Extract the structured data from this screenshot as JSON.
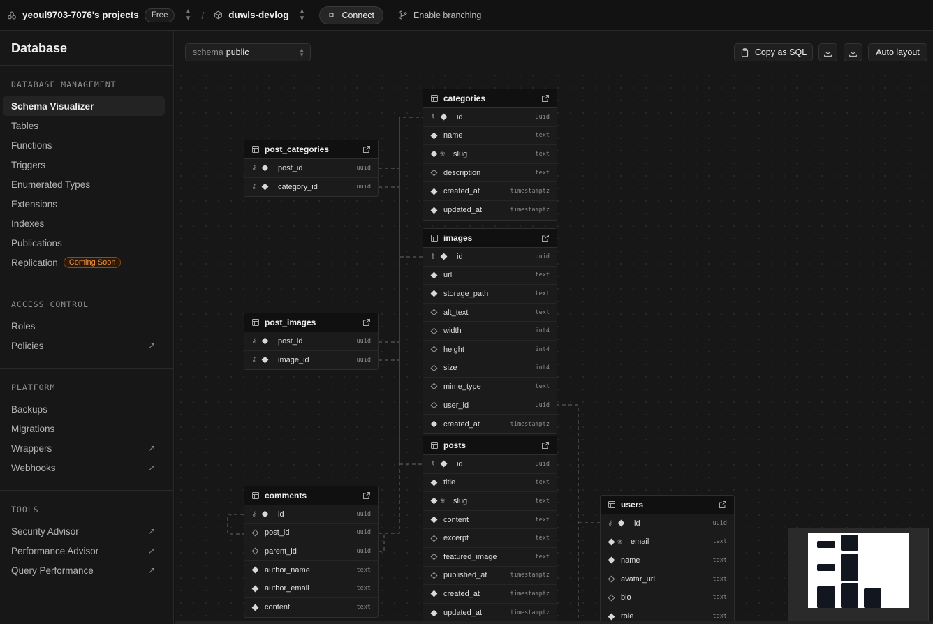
{
  "topbar": {
    "org": "yeoul9703-7076's projects",
    "plan": "Free",
    "project": "duwls-devlog",
    "connect": "Connect",
    "branching": "Enable branching"
  },
  "sidebar": {
    "title": "Database",
    "sections": [
      {
        "heading": "DATABASE MANAGEMENT",
        "items": [
          {
            "label": "Schema Visualizer",
            "active": true
          },
          {
            "label": "Tables"
          },
          {
            "label": "Functions"
          },
          {
            "label": "Triggers"
          },
          {
            "label": "Enumerated Types"
          },
          {
            "label": "Extensions"
          },
          {
            "label": "Indexes"
          },
          {
            "label": "Publications"
          },
          {
            "label": "Replication",
            "badge": "Coming Soon"
          }
        ]
      },
      {
        "heading": "ACCESS CONTROL",
        "items": [
          {
            "label": "Roles"
          },
          {
            "label": "Policies",
            "external": true
          }
        ]
      },
      {
        "heading": "PLATFORM",
        "items": [
          {
            "label": "Backups"
          },
          {
            "label": "Migrations"
          },
          {
            "label": "Wrappers",
            "external": true
          },
          {
            "label": "Webhooks",
            "external": true
          }
        ]
      },
      {
        "heading": "TOOLS",
        "items": [
          {
            "label": "Security Advisor",
            "external": true
          },
          {
            "label": "Performance Advisor",
            "external": true
          },
          {
            "label": "Query Performance",
            "external": true
          }
        ]
      }
    ]
  },
  "toolbar": {
    "schema_label": "schema",
    "schema_value": "public",
    "copy_sql": "Copy as SQL",
    "auto_layout": "Auto layout"
  },
  "tables": {
    "categories": {
      "name": "categories",
      "columns": [
        {
          "name": "id",
          "type": "uuid",
          "pk": true,
          "nullable": false
        },
        {
          "name": "name",
          "type": "text",
          "nullable": false
        },
        {
          "name": "slug",
          "type": "text",
          "unique": true,
          "nullable": false
        },
        {
          "name": "description",
          "type": "text",
          "nullable": true
        },
        {
          "name": "created_at",
          "type": "timestamptz",
          "nullable": false
        },
        {
          "name": "updated_at",
          "type": "timestamptz",
          "nullable": false
        }
      ]
    },
    "post_categories": {
      "name": "post_categories",
      "columns": [
        {
          "name": "post_id",
          "type": "uuid",
          "pk": true,
          "nullable": false
        },
        {
          "name": "category_id",
          "type": "uuid",
          "pk": true,
          "nullable": false
        }
      ]
    },
    "images": {
      "name": "images",
      "columns": [
        {
          "name": "id",
          "type": "uuid",
          "pk": true,
          "nullable": false
        },
        {
          "name": "url",
          "type": "text",
          "nullable": false
        },
        {
          "name": "storage_path",
          "type": "text",
          "nullable": false
        },
        {
          "name": "alt_text",
          "type": "text",
          "nullable": true
        },
        {
          "name": "width",
          "type": "int4",
          "nullable": true
        },
        {
          "name": "height",
          "type": "int4",
          "nullable": true
        },
        {
          "name": "size",
          "type": "int4",
          "nullable": true
        },
        {
          "name": "mime_type",
          "type": "text",
          "nullable": true
        },
        {
          "name": "user_id",
          "type": "uuid",
          "nullable": true
        },
        {
          "name": "created_at",
          "type": "timestamptz",
          "nullable": false
        }
      ]
    },
    "post_images": {
      "name": "post_images",
      "columns": [
        {
          "name": "post_id",
          "type": "uuid",
          "pk": true,
          "nullable": false
        },
        {
          "name": "image_id",
          "type": "uuid",
          "pk": true,
          "nullable": false
        }
      ]
    },
    "posts": {
      "name": "posts",
      "columns": [
        {
          "name": "id",
          "type": "uuid",
          "pk": true,
          "nullable": false
        },
        {
          "name": "title",
          "type": "text",
          "nullable": false
        },
        {
          "name": "slug",
          "type": "text",
          "unique": true,
          "nullable": false
        },
        {
          "name": "content",
          "type": "text",
          "nullable": false
        },
        {
          "name": "excerpt",
          "type": "text",
          "nullable": true
        },
        {
          "name": "featured_image",
          "type": "text",
          "nullable": true
        },
        {
          "name": "published_at",
          "type": "timestamptz",
          "nullable": true
        },
        {
          "name": "created_at",
          "type": "timestamptz",
          "nullable": false
        },
        {
          "name": "updated_at",
          "type": "timestamptz",
          "nullable": false
        }
      ]
    },
    "comments": {
      "name": "comments",
      "columns": [
        {
          "name": "id",
          "type": "uuid",
          "pk": true,
          "nullable": false
        },
        {
          "name": "post_id",
          "type": "uuid",
          "nullable": true
        },
        {
          "name": "parent_id",
          "type": "uuid",
          "nullable": true
        },
        {
          "name": "author_name",
          "type": "text",
          "nullable": false
        },
        {
          "name": "author_email",
          "type": "text",
          "nullable": false
        },
        {
          "name": "content",
          "type": "text",
          "nullable": false
        }
      ]
    },
    "users": {
      "name": "users",
      "columns": [
        {
          "name": "id",
          "type": "uuid",
          "pk": true,
          "nullable": false
        },
        {
          "name": "email",
          "type": "text",
          "unique": true,
          "nullable": false
        },
        {
          "name": "name",
          "type": "text",
          "nullable": false
        },
        {
          "name": "avatar_url",
          "type": "text",
          "nullable": true
        },
        {
          "name": "bio",
          "type": "text",
          "nullable": true
        },
        {
          "name": "role",
          "type": "text",
          "nullable": false
        }
      ]
    }
  }
}
